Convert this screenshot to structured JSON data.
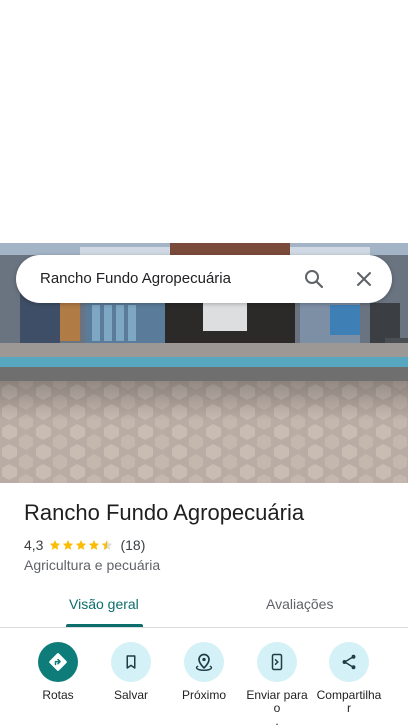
{
  "search": {
    "query": "Rancho Fundo Agropecuária"
  },
  "place": {
    "name": "Rancho Fundo Agropecuária",
    "rating": "4,3",
    "rating_value": 4.3,
    "review_count": "(18)",
    "category": "Agricultura e pecuária"
  },
  "tabs": {
    "overview": "Visão geral",
    "reviews": "Avaliações",
    "active": "overview"
  },
  "actions": [
    {
      "label": "Rotas",
      "icon": "directions-icon"
    },
    {
      "label": "Salvar",
      "icon": "bookmark-icon"
    },
    {
      "label": "Próximo",
      "icon": "nearby-icon"
    },
    {
      "label": "Enviar para\no\n.",
      "icon": "send-to-phone-icon"
    },
    {
      "label": "Compartilha\nr",
      "icon": "share-icon"
    }
  ],
  "colors": {
    "accent": "#0e7c79",
    "tab_active": "#0b6e6b",
    "action_bg": "#d3f1f6",
    "star": "#fbbc04"
  }
}
